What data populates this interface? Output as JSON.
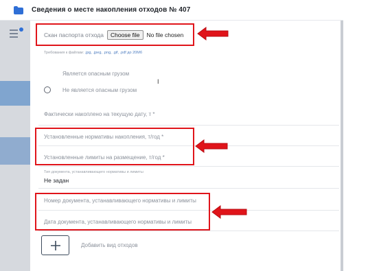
{
  "header": {
    "title": "Сведения о месте накопления отходов № 407"
  },
  "form": {
    "passport_scan_label": "Скан паспорта отхода",
    "choose_file_label": "Choose file",
    "no_file_label": "No file chosen",
    "file_requirements_prefix": "Требования к файлам:",
    "file_requirements_exts": ".jpg, .jpeg, .png, .gif, .pdf до 20Мб",
    "radio_dangerous": "Является опасным грузом",
    "radio_not_dangerous": "Не является опасным грузом",
    "accumulated_label": "Фактически накоплено на текущую дату, т *",
    "norms_label": "Установленные нормативы накопления, т/год *",
    "limits_label": "Установленные лимиты на размещение, т/год *",
    "doc_type_caption": "Тип документа, устанавливающего нормативы и лимиты",
    "doc_type_value": "Не задан",
    "doc_number_label": "Номер документа, устанавливающего нормативы и лимиты",
    "doc_date_label": "Дата документа, устанавливающего нормативы и лимиты",
    "add_waste_label": "Добавить вид отходов",
    "add_icon": "plus-icon"
  },
  "annotations": {
    "highlight_color": "#e0141a",
    "arrow_color": "#e0141a"
  }
}
